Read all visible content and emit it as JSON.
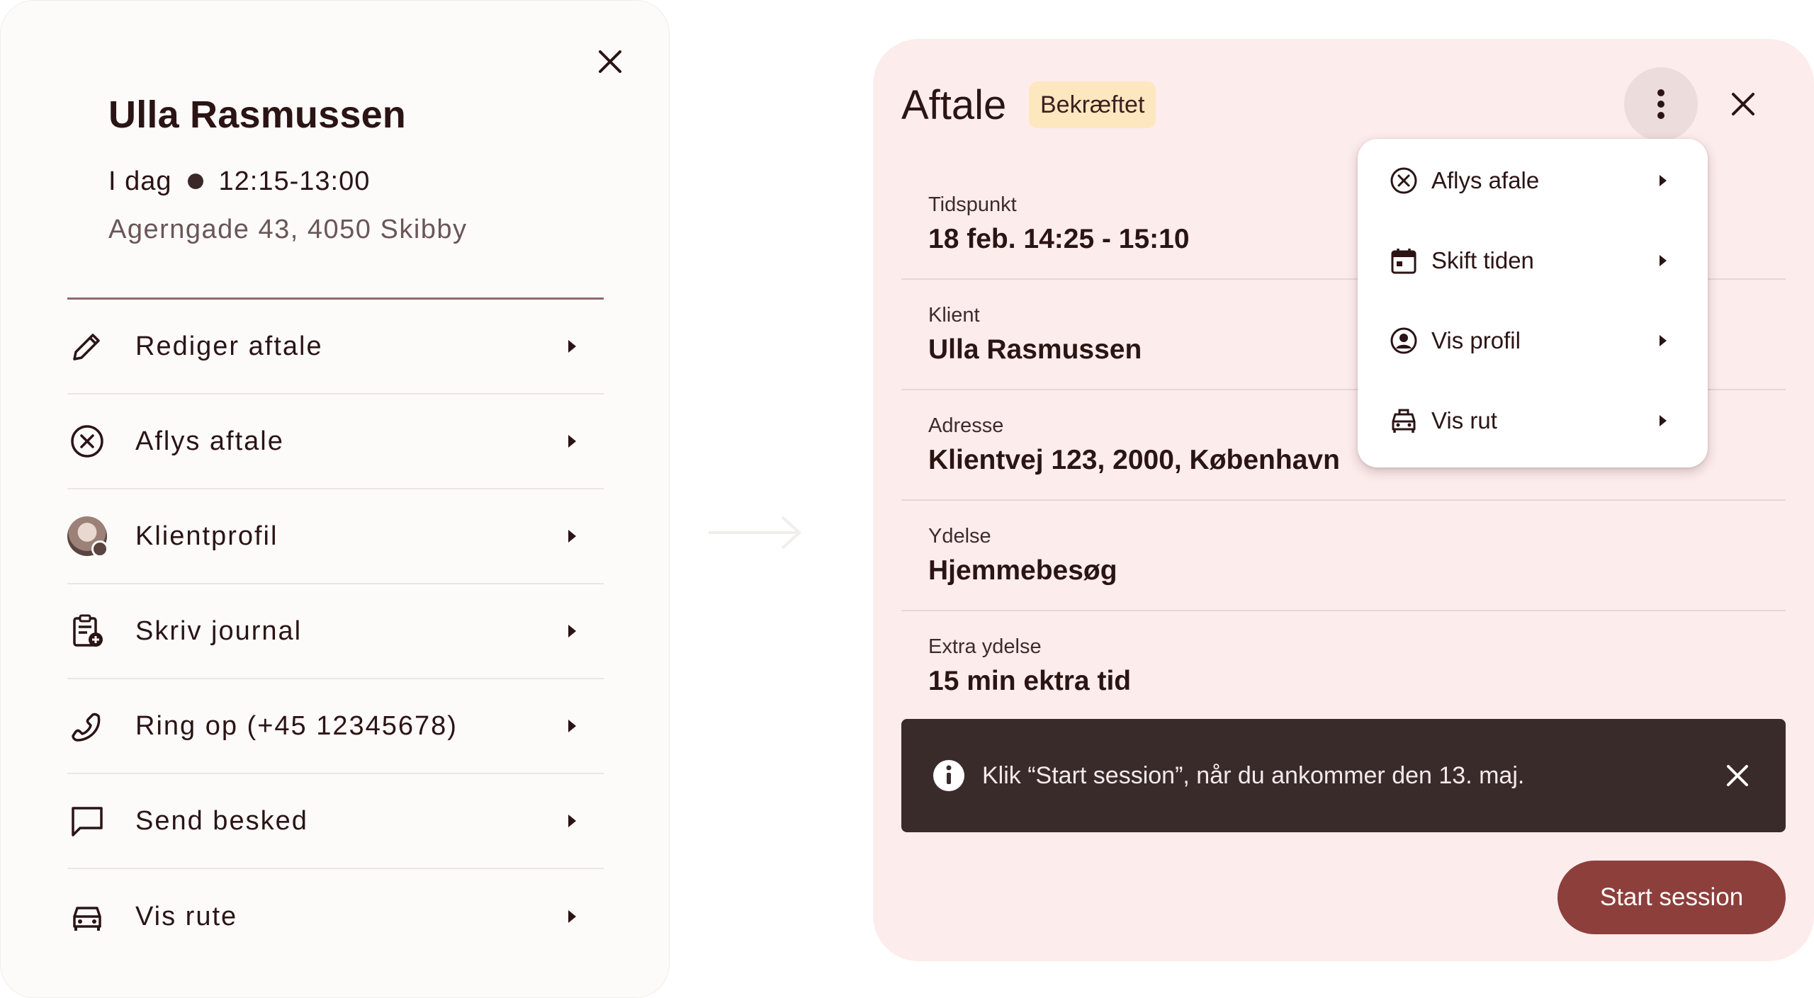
{
  "left_panel": {
    "client_name": "Ulla Rasmussen",
    "day": "I dag",
    "time": "12:15-13:00",
    "address": "Agerngade 43, 4050 Skibby",
    "menu": [
      {
        "label": "Rediger aftale",
        "icon": "pencil-icon"
      },
      {
        "label": "Aflys aftale",
        "icon": "cancel-circle-icon"
      },
      {
        "label": "Klientprofil",
        "icon": "avatar"
      },
      {
        "label": "Skriv journal",
        "icon": "journal-add-icon"
      },
      {
        "label": "Ring op (+45 12345678)",
        "icon": "phone-icon"
      },
      {
        "label": "Send besked",
        "icon": "chat-bubble-icon"
      },
      {
        "label": "Vis rute",
        "icon": "car-icon"
      }
    ]
  },
  "card": {
    "title": "Aftale",
    "status": "Bekræftet",
    "fields": [
      {
        "label": "Tidspunkt",
        "value": "18 feb. 14:25 - 15:10"
      },
      {
        "label": "Klient",
        "value": "Ulla Rasmussen"
      },
      {
        "label": "Adresse",
        "value": "Klientvej 123, 2000, København"
      },
      {
        "label": "Ydelse",
        "value": "Hjemmebesøg"
      },
      {
        "label": "Extra ydelse",
        "value": "15 min ektra tid"
      }
    ],
    "snackbar_text": "Klik “Start session”, når du ankommer den 13. maj.",
    "start_button": "Start session"
  },
  "dropdown": {
    "items": [
      {
        "label": "Aflys afale",
        "icon": "cancel-circle-icon"
      },
      {
        "label": "Skift tiden",
        "icon": "calendar-icon"
      },
      {
        "label": "Vis profil",
        "icon": "profile-circle-icon"
      },
      {
        "label": "Vis rut",
        "icon": "car-icon"
      }
    ]
  },
  "colors": {
    "accent": "#8d3f3b",
    "card_bg": "#fdecec",
    "badge_bg": "#fde7bf",
    "snackbar_bg": "#3a2b2b"
  }
}
